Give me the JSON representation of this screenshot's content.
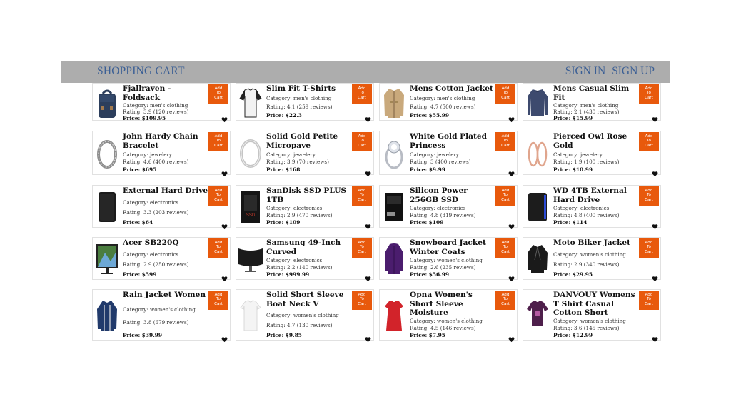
{
  "header": {
    "brand": "SHOPPING CART",
    "sign_in": "SIGN IN",
    "sign_up": "SIGN UP"
  },
  "add_label": "Add\nTo\nCart",
  "products": [
    {
      "title": "Fjallraven - Foldsack",
      "category": "Category: men's clothing",
      "rating": "Rating: 3.9 (120 reviews)",
      "price": "Price: $109.95",
      "icon": "backpack-icon"
    },
    {
      "title": "Slim Fit T-Shirts",
      "category": "Category: men's clothing",
      "rating": "Rating: 4.1 (259 reviews)",
      "price": "Price: $22.3",
      "icon": "tshirt-icon"
    },
    {
      "title": "Mens Cotton Jacket",
      "category": "Category: men's clothing",
      "rating": "Rating: 4.7 (500 reviews)",
      "price": "Price: $55.99",
      "icon": "jacket-icon"
    },
    {
      "title": "Mens Casual Slim Fit",
      "category": "Category: men's clothing",
      "rating": "Rating: 2.1 (430 reviews)",
      "price": "Price: $15.99",
      "icon": "longsleeve-icon"
    },
    {
      "title": "John Hardy Chain Bracelet",
      "category": "Category: jewelery",
      "rating": "Rating: 4.6 (400 reviews)",
      "price": "Price: $695",
      "icon": "bracelet-icon"
    },
    {
      "title": "Solid Gold Petite Micropave",
      "category": "Category: jewelery",
      "rating": "Rating: 3.9 (70 reviews)",
      "price": "Price: $168",
      "icon": "ring-icon"
    },
    {
      "title": "White Gold Plated Princess",
      "category": "Category: jewelery",
      "rating": "Rating: 3 (400 reviews)",
      "price": "Price: $9.99",
      "icon": "diamond-ring-icon"
    },
    {
      "title": "Pierced Owl Rose Gold",
      "category": "Category: jewelery",
      "rating": "Rating: 1.9 (100 reviews)",
      "price": "Price: $10.99",
      "icon": "earrings-icon"
    },
    {
      "title": "External Hard Drive",
      "category": "Category: electronics",
      "rating": "Rating: 3.3 (203 reviews)",
      "price": "Price: $64",
      "icon": "hard-drive-icon"
    },
    {
      "title": "SanDisk SSD PLUS 1TB",
      "category": "Category: electronics",
      "rating": "Rating: 2.9 (470 reviews)",
      "price": "Price: $109",
      "icon": "ssd-icon"
    },
    {
      "title": "Silicon Power 256GB SSD",
      "category": "Category: electronics",
      "rating": "Rating: 4.8 (319 reviews)",
      "price": "Price: $109",
      "icon": "ssd-box-icon"
    },
    {
      "title": "WD 4TB External Hard Drive",
      "category": "Category: electronics",
      "rating": "Rating: 4.8 (400 reviews)",
      "price": "Price: $114",
      "icon": "external-drive-icon"
    },
    {
      "title": "Acer SB220Q",
      "category": "Category: electronics",
      "rating": "Rating: 2.9 (250 reviews)",
      "price": "Price: $599",
      "icon": "monitor-icon"
    },
    {
      "title": "Samsung 49-Inch Curved",
      "category": "Category: electronics",
      "rating": "Rating: 2.2 (140 reviews)",
      "price": "Price: $999.99",
      "icon": "curved-monitor-icon"
    },
    {
      "title": "Snowboard Jacket Winter Coats",
      "category": "Category: women's clothing",
      "rating": "Rating: 2.6 (235 reviews)",
      "price": "Price: $56.99",
      "icon": "winter-coat-icon"
    },
    {
      "title": "Moto Biker Jacket",
      "category": "Category: women's clothing",
      "rating": "Rating: 2.9 (340 reviews)",
      "price": "Price: $29.95",
      "icon": "biker-jacket-icon"
    },
    {
      "title": "Rain Jacket Women",
      "category": "Category: women's clothing",
      "rating": "Rating: 3.8 (679 reviews)",
      "price": "Price: $39.99",
      "icon": "rain-jacket-icon"
    },
    {
      "title": "Solid Short Sleeve Boat Neck V",
      "category": "Category: women's clothing",
      "rating": "Rating: 4.7 (130 reviews)",
      "price": "Price: $9.85",
      "icon": "white-top-icon"
    },
    {
      "title": "Opna Women's Short Sleeve Moisture",
      "category": "Category: women's clothing",
      "rating": "Rating: 4.5 (146 reviews)",
      "price": "Price: $7.95",
      "icon": "red-dress-icon"
    },
    {
      "title": "DANVOUY Womens T Shirt Casual Cotton Short",
      "category": "Category: women's clothing",
      "rating": "Rating: 3.6 (145 reviews)",
      "price": "Price: $12.99",
      "icon": "purple-tshirt-icon"
    }
  ]
}
